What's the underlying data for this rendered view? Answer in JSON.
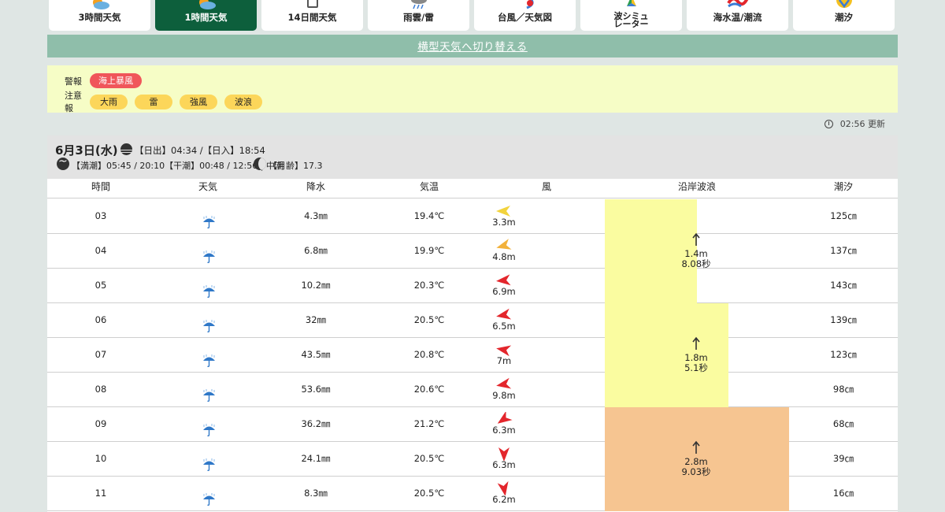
{
  "tabs": [
    {
      "label": "3時間天気",
      "icon": "sun-cloud-icon",
      "active": false
    },
    {
      "label": "1時間天気",
      "icon": "sun-cloud-icon",
      "active": true
    },
    {
      "label": "14日間天気",
      "icon": "calendar-icon",
      "active": false
    },
    {
      "label": "雨雲/雷",
      "icon": "rain-lightning-icon",
      "active": false
    },
    {
      "label": "台風／天気図",
      "icon": "typhoon-icon",
      "active": false
    },
    {
      "label": "波シミュ\nレーター",
      "icon": "wave-sim-icon",
      "active": false
    },
    {
      "label": "海水温/潮流",
      "icon": "sea-temp-icon",
      "active": false
    },
    {
      "label": "潮汐",
      "icon": "tide-icon",
      "active": false
    }
  ],
  "switch_link": "横型天気へ切り替える",
  "warnings": {
    "keiho_label": "警報",
    "keiho": [
      "海上暴風"
    ],
    "chuiho_label": "注意報",
    "chuiho": [
      "大雨",
      "雷",
      "強風",
      "波浪"
    ]
  },
  "updated": "02:56 更新",
  "info": {
    "date": "6月3日(水)",
    "sun": "【日出】04:34 /【日入】18:54",
    "tide": "【満潮】05:45 / 20:10【干潮】00:48 / 12:56 | 中潮",
    "moon": "【月齢】17.3"
  },
  "table": {
    "headers": {
      "time": "時間",
      "weather": "天気",
      "rain": "降水",
      "temp": "気温",
      "wind": "風",
      "wave": "沿岸波浪",
      "tide": "潮汐"
    },
    "rows": [
      {
        "time": "03",
        "rain": "4.3㎜",
        "temp": "19.4℃",
        "wind_speed": "3.3m",
        "wind_color": "#f2d33c",
        "wind_dir": 250,
        "tide": "125㎝"
      },
      {
        "time": "04",
        "rain": "6.8㎜",
        "temp": "19.9℃",
        "wind_speed": "4.8m",
        "wind_color": "#f2b13a",
        "wind_dir": 235,
        "tide": "137㎝"
      },
      {
        "time": "05",
        "rain": "10.2㎜",
        "temp": "20.3℃",
        "wind_speed": "6.9m",
        "wind_color": "#e3262c",
        "wind_dir": 245,
        "tide": "143㎝"
      },
      {
        "time": "06",
        "rain": "32㎜",
        "temp": "20.5℃",
        "wind_speed": "6.5m",
        "wind_color": "#e3262c",
        "wind_dir": 240,
        "tide": "139㎝"
      },
      {
        "time": "07",
        "rain": "43.5㎜",
        "temp": "20.8℃",
        "wind_speed": "7m",
        "wind_color": "#e3262c",
        "wind_dir": 260,
        "tide": "123㎝"
      },
      {
        "time": "08",
        "rain": "53.6㎜",
        "temp": "20.6℃",
        "wind_speed": "9.8m",
        "wind_color": "#e3262c",
        "wind_dir": 240,
        "tide": "98㎝"
      },
      {
        "time": "09",
        "rain": "36.2㎜",
        "temp": "21.2℃",
        "wind_speed": "6.3m",
        "wind_color": "#e3262c",
        "wind_dir": 215,
        "tide": "68㎝"
      },
      {
        "time": "10",
        "rain": "24.1㎜",
        "temp": "20.5℃",
        "wind_speed": "6.3m",
        "wind_color": "#e3262c",
        "wind_dir": 160,
        "tide": "39㎝"
      },
      {
        "time": "11",
        "rain": "8.3㎜",
        "temp": "20.5℃",
        "wind_speed": "6.2m",
        "wind_color": "#e3262c",
        "wind_dir": 150,
        "tide": "16㎝"
      }
    ],
    "waves": [
      {
        "height": "1.4m",
        "period": "8.08秒",
        "color": "#fafca0",
        "fill_fraction": 0.5
      },
      {
        "height": "1.8m",
        "period": "5.1秒",
        "color": "#fafca0",
        "fill_fraction": 0.67
      },
      {
        "height": "2.8m",
        "period": "9.03秒",
        "color": "#f6c591",
        "fill_fraction": 1.0
      }
    ]
  }
}
